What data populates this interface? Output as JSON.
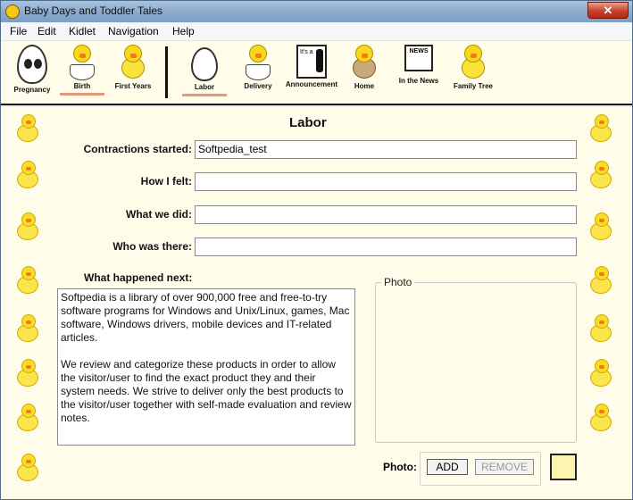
{
  "window": {
    "title": "Baby Days and Toddler Tales",
    "close_label": "✕"
  },
  "menu": [
    "File",
    "Edit",
    "Kidlet",
    "Navigation",
    "Help"
  ],
  "toolbar": {
    "items": [
      {
        "label": "Pregnancy",
        "icon": "egg-face-icon"
      },
      {
        "label": "Birth",
        "icon": "hatching-chick-icon"
      },
      {
        "label": "First Years",
        "icon": "chick-icon"
      },
      {
        "label": "Labor",
        "icon": "cracked-egg-icon"
      },
      {
        "label": "Delivery",
        "icon": "chick-in-shell-icon"
      },
      {
        "label": "Announcement",
        "icon": "announcement-icon"
      },
      {
        "label": "Home",
        "icon": "chick-nest-icon"
      },
      {
        "label": "In the News",
        "icon": "newspaper-icon"
      },
      {
        "label": "Family Tree",
        "icon": "chick-family-icon"
      }
    ],
    "announcement_text": "It's a",
    "news_text": "NEWS"
  },
  "page": {
    "title": "Labor",
    "fields": [
      {
        "label": "Contractions started:",
        "value": "Softpedia_test"
      },
      {
        "label": "How I felt:",
        "value": ""
      },
      {
        "label": "What we did:",
        "value": ""
      },
      {
        "label": "Who was there:",
        "value": ""
      }
    ],
    "notes_label": "What happened next:",
    "notes_p1": "Softpedia is a library of over 900,000 free and free-to-try software programs for Windows and Unix/Linux, games, Mac software, Windows drivers, mobile devices and IT-related articles.",
    "notes_p2": "We review and categorize these products in order to allow the visitor/user to find the exact product they and their system needs. We strive to deliver only the best products to the visitor/user together with self-made evaluation and review notes.",
    "photo_caption": "Photo",
    "photo_label": "Photo:",
    "add_label": "ADD",
    "remove_label": "REMOVE"
  }
}
